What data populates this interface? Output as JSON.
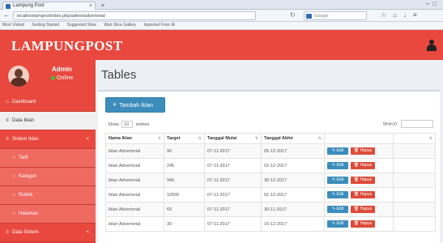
{
  "browser": {
    "tab_title": "Lampung Post",
    "url": "localhost/project/index.php/admin/advertorial",
    "search_placeholder": "Google",
    "bookmarks": [
      "Most Visited",
      "Getting Started",
      "Suggested Sites",
      "Web Slice Gallery",
      "Imported From IE"
    ]
  },
  "header": {
    "brand": "LAMPUNGPOST"
  },
  "sidebar": {
    "user_name": "Admin",
    "user_status": "Online",
    "items": [
      {
        "label": "Dashboard",
        "icon": "home-icon",
        "type": "main"
      },
      {
        "label": "Data Iklan",
        "icon": "list-icon",
        "type": "active"
      },
      {
        "label": "Sistem Iklan",
        "icon": "list-icon",
        "type": "main",
        "caret": "<"
      },
      {
        "label": "Tarif",
        "icon": "circle-icon",
        "type": "sub"
      },
      {
        "label": "Kategori",
        "icon": "circle-icon",
        "type": "sub"
      },
      {
        "label": "Rubrik",
        "icon": "circle-icon",
        "type": "sub"
      },
      {
        "label": "Halaman",
        "icon": "circle-icon",
        "type": "sub"
      },
      {
        "label": "Data Sistem",
        "icon": "list-icon",
        "type": "main",
        "caret": "<"
      }
    ]
  },
  "main": {
    "title": "Tables",
    "add_button": "Tambah Iklan",
    "length_prefix": "Show",
    "length_value": "10",
    "length_suffix": "entries",
    "search_label": "Search:",
    "columns": [
      "Nama Iklan",
      "Target",
      "Tanggal Mulai",
      "Tanggal Akhir",
      "",
      ""
    ],
    "rows": [
      {
        "nama": "Iklan Advertorial",
        "target": "90",
        "mulai": "07-11-2017",
        "akhir": "05-12-2017"
      },
      {
        "nama": "Iklan Advertorial",
        "target": "245",
        "mulai": "07-11-2017",
        "akhir": "02-12-2017"
      },
      {
        "nama": "Iklan Advertorial",
        "target": "940",
        "mulai": "07-11-2017",
        "akhir": "30-12-2017"
      },
      {
        "nama": "Iklan Advertorial",
        "target": "10500",
        "mulai": "07-11-2017",
        "akhir": "01-12-2017"
      },
      {
        "nama": "Iklan Advertorial",
        "target": "60",
        "mulai": "07-11-2017",
        "akhir": "30-11-2017"
      },
      {
        "nama": "Iklan Advertorial",
        "target": "30",
        "mulai": "07-11-2017",
        "akhir": "15-12-2017"
      }
    ],
    "edit_label": "Edit",
    "delete_label": "Hapus"
  },
  "colors": {
    "brand_red": "#e8483d",
    "primary_blue": "#3c8dbc",
    "danger_red": "#dd4b39"
  }
}
